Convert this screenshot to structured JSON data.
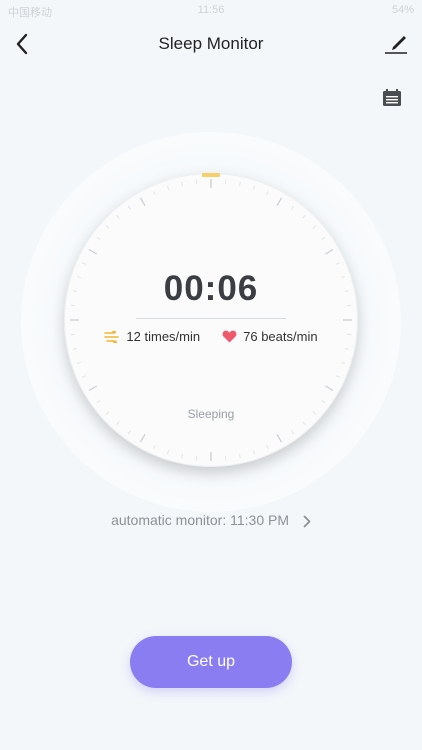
{
  "status_bar": {
    "carrier": "中国移动",
    "time": "11:56",
    "battery": "54%"
  },
  "nav": {
    "title": "Sleep Monitor",
    "back_icon": "chevron-left-icon",
    "edit_icon": "edit-pen-icon"
  },
  "toolbar": {
    "calendar_icon": "calendar-icon"
  },
  "monitor": {
    "elapsed": "00:06",
    "breathing_rate": "12 times/min",
    "heart_rate": "76 beats/min",
    "state": "Sleeping",
    "breath_icon_color": "#f3b531",
    "heart_icon_color": "#ee5a6c",
    "marker_color": "#f5d06a"
  },
  "auto_monitor": {
    "label": "automatic monitor: 11:30 PM"
  },
  "actions": {
    "get_up": "Get up",
    "accent": "#8a7df2"
  }
}
